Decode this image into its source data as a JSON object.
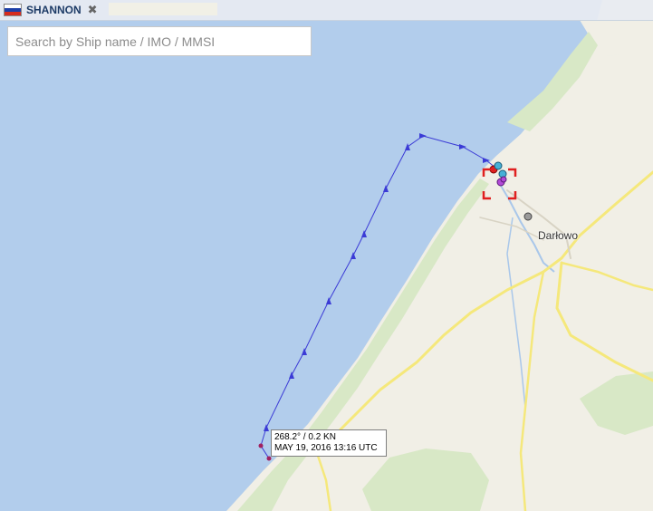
{
  "tab": {
    "ship_name": "SHANNON",
    "close_icon": "close-x-icon",
    "flag": {
      "icon": "russia-flag-icon",
      "colors": [
        "#ffffff",
        "#1c3fa8",
        "#d52b1e"
      ]
    }
  },
  "search": {
    "placeholder": "Search by Ship name / IMO / MMSI",
    "value": ""
  },
  "map": {
    "town_label": "Darłowo",
    "colors": {
      "sea": "#b2cdec",
      "land": "#f1efe6",
      "green": "#d8e8c6",
      "road": "#f5e87b",
      "track": "#3b3bd6"
    },
    "track_point_tooltip": {
      "heading_speed": "268.2° / 0.2 KN",
      "timestamp": "MAY 19, 2016 13:16 UTC"
    }
  }
}
